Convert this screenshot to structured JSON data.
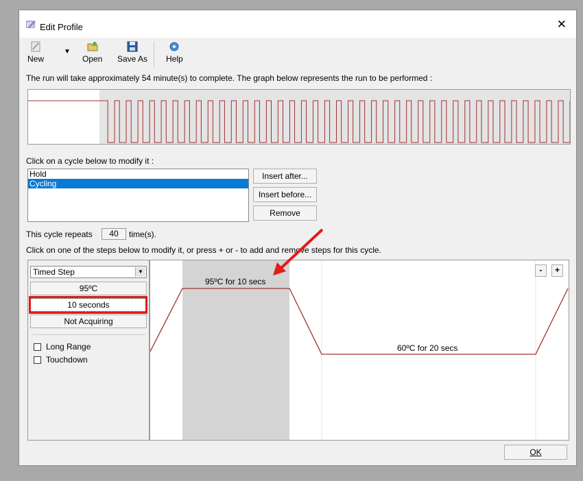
{
  "window": {
    "title": "Edit Profile",
    "close_glyph": "✕"
  },
  "toolbar": {
    "new_label": "New",
    "open_label": "Open",
    "save_as_label": "Save As",
    "help_label": "Help",
    "dropdown_glyph": "▼"
  },
  "run_info": "The run will take approximately 54 minute(s) to complete. The graph below represents the run to be performed :",
  "cycles": {
    "prompt": "Click on a cycle below to modify it :",
    "items": [
      "Hold",
      "Cycling"
    ],
    "selected": "Cycling",
    "insert_after_label": "Insert after...",
    "insert_before_label": "Insert before...",
    "remove_label": "Remove"
  },
  "repeat": {
    "prefix": "This cycle repeats",
    "count": "40",
    "suffix": "time(s)."
  },
  "steps_prompt": "Click on one of the steps below to modify it, or press + or - to add and remove steps for this cycle.",
  "step": {
    "type": "Timed Step",
    "temperature": "95ºC",
    "duration": "10 seconds",
    "acquiring": "Not Acquiring",
    "long_range_label": "Long Range",
    "touchdown_label": "Touchdown"
  },
  "graph": {
    "minus_label": "-",
    "plus_label": "+",
    "step1_label": "95ºC for 10 secs",
    "step2_label": "60ºC for 20 secs"
  },
  "ok_label": "OK",
  "colors": {
    "trace": "#a03030",
    "highlight": "#e21b1b",
    "selection": "#0a7ad4"
  }
}
